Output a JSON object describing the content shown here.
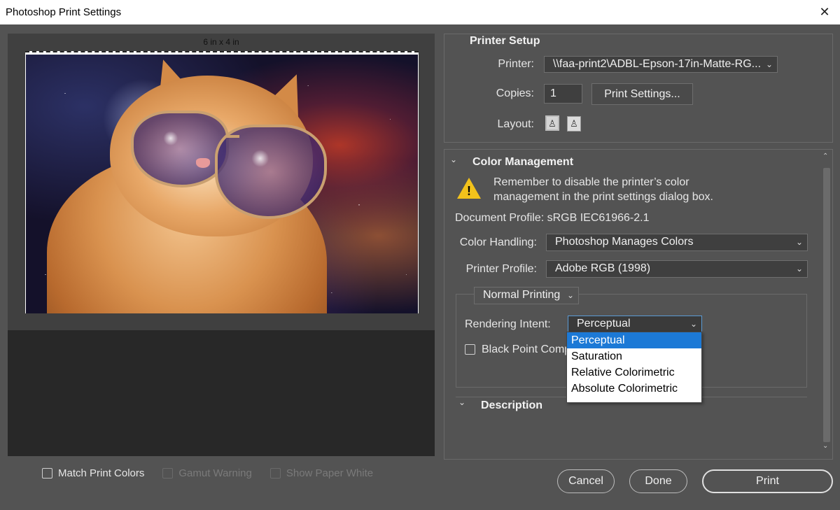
{
  "window": {
    "title": "Photoshop Print Settings",
    "close_glyph": "✕"
  },
  "preview": {
    "size_label": "6 in x 4 in",
    "options": [
      {
        "label": "Match Print Colors",
        "enabled": true,
        "checked": false
      },
      {
        "label": "Gamut Warning",
        "enabled": false,
        "checked": false
      },
      {
        "label": "Show Paper White",
        "enabled": false,
        "checked": false
      }
    ]
  },
  "printer_setup": {
    "title": "Printer Setup",
    "printer_label": "Printer:",
    "printer_value": "\\\\faa-print2\\ADBL-Epson-17in-Matte-RG...",
    "copies_label": "Copies:",
    "copies_value": "1",
    "print_settings_button": "Print Settings...",
    "layout_label": "Layout:",
    "layout_icons": [
      "portrait-layout-icon",
      "landscape-layout-icon"
    ]
  },
  "color_management": {
    "title": "Color Management",
    "warning_text_1": "Remember to disable the printer’s color",
    "warning_text_2": "management in the print settings dialog box.",
    "document_profile": "Document Profile: sRGB IEC61966-2.1",
    "color_handling_label": "Color Handling:",
    "color_handling_value": "Photoshop Manages Colors",
    "printer_profile_label": "Printer Profile:",
    "printer_profile_value": "Adobe RGB (1998)",
    "printing_mode_value": "Normal Printing",
    "rendering_intent_label": "Rendering Intent:",
    "rendering_intent_value": "Perceptual",
    "rendering_intent_options": [
      "Perceptual",
      "Saturation",
      "Relative Colorimetric",
      "Absolute Colorimetric"
    ],
    "black_point_label": "Black Point Comp"
  },
  "description": {
    "title": "Description"
  },
  "footer": {
    "cancel": "Cancel",
    "done": "Done",
    "print": "Print"
  },
  "colors": {
    "background": "#535353",
    "preview_bg": "#282828",
    "menu_selected": "#1c79d6",
    "warning": "#f2c21b"
  }
}
